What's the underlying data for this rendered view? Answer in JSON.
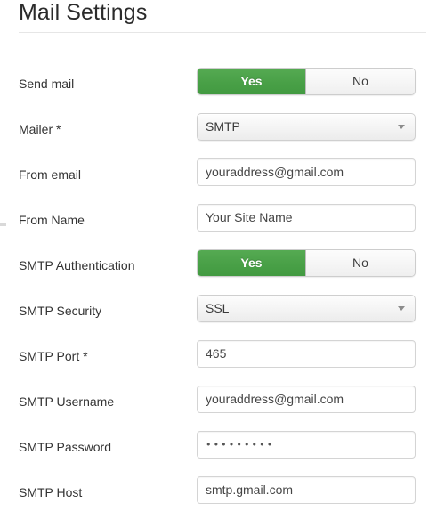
{
  "header": {
    "title": "Mail Settings"
  },
  "toggle_options": {
    "yes_label": "Yes",
    "no_label": "No"
  },
  "colors": {
    "toggle_on_green": "#49a047",
    "label_text": "#333333",
    "input_border": "#d4d4d4",
    "rule": "#e6e6e6"
  },
  "rows": [
    {
      "label": "Send mail",
      "type": "toggle",
      "name": "send-mail",
      "selected": "Yes"
    },
    {
      "label": "Mailer *",
      "type": "select",
      "name": "mailer",
      "value": "SMTP"
    },
    {
      "label": "From email",
      "type": "text",
      "name": "from-email",
      "value": "youraddress@gmail.com"
    },
    {
      "label": "From Name",
      "type": "text",
      "name": "from-name",
      "value": "Your Site Name"
    },
    {
      "label": "SMTP Authentication",
      "type": "toggle",
      "name": "smtp-authentication",
      "selected": "Yes"
    },
    {
      "label": "SMTP Security",
      "type": "select",
      "name": "smtp-security",
      "value": "SSL"
    },
    {
      "label": "SMTP Port *",
      "type": "text",
      "name": "smtp-port",
      "value": "465"
    },
    {
      "label": "SMTP Username",
      "type": "text",
      "name": "smtp-username",
      "value": "youraddress@gmail.com"
    },
    {
      "label": "SMTP Password",
      "type": "password",
      "name": "smtp-password",
      "value": "•••••••••"
    },
    {
      "label": "SMTP Host",
      "type": "text",
      "name": "smtp-host",
      "value": "smtp.gmail.com"
    }
  ]
}
